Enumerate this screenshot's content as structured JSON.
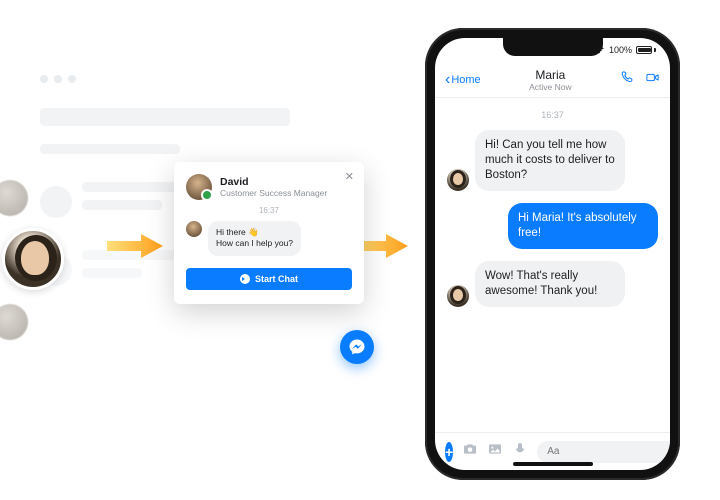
{
  "widget": {
    "agent_name": "David",
    "agent_role": "Customer Success Manager",
    "timestamp": "16:37",
    "greeting_line1": "Hi there 👋",
    "greeting_line2": "How can I help you?",
    "start_chat_label": "Start Chat",
    "close_glyph": "✕"
  },
  "phone": {
    "status": {
      "carrier_bars": "ıll",
      "wifi": "wifi",
      "battery_pct": "100%"
    },
    "nav": {
      "back_label": "Home",
      "title": "Maria",
      "subtitle": "Active Now"
    },
    "chat": {
      "timestamp": "16:37",
      "messages": [
        {
          "side": "left",
          "text": "Hi! Can you tell me how much it costs to deliver to Boston?"
        },
        {
          "side": "right",
          "text": "Hi Maria! It's absolutely free!"
        },
        {
          "side": "left",
          "text": "Wow! That's really awesome! Thank you!"
        }
      ],
      "composer_placeholder": "Aa"
    }
  },
  "icons": {
    "messenger": "messenger-icon",
    "phone": "phone-icon",
    "video": "video-icon",
    "camera": "camera-icon",
    "gallery": "gallery-icon",
    "mic": "mic-icon",
    "emoji": "emoji-icon",
    "like": "like-icon",
    "plus": "+",
    "chevron_left": "‹"
  },
  "colors": {
    "primary": "#0a7cff",
    "bubble_grey": "#eff1f3",
    "arrow_a": "#ffd24a",
    "arrow_b": "#ff9e1b"
  }
}
